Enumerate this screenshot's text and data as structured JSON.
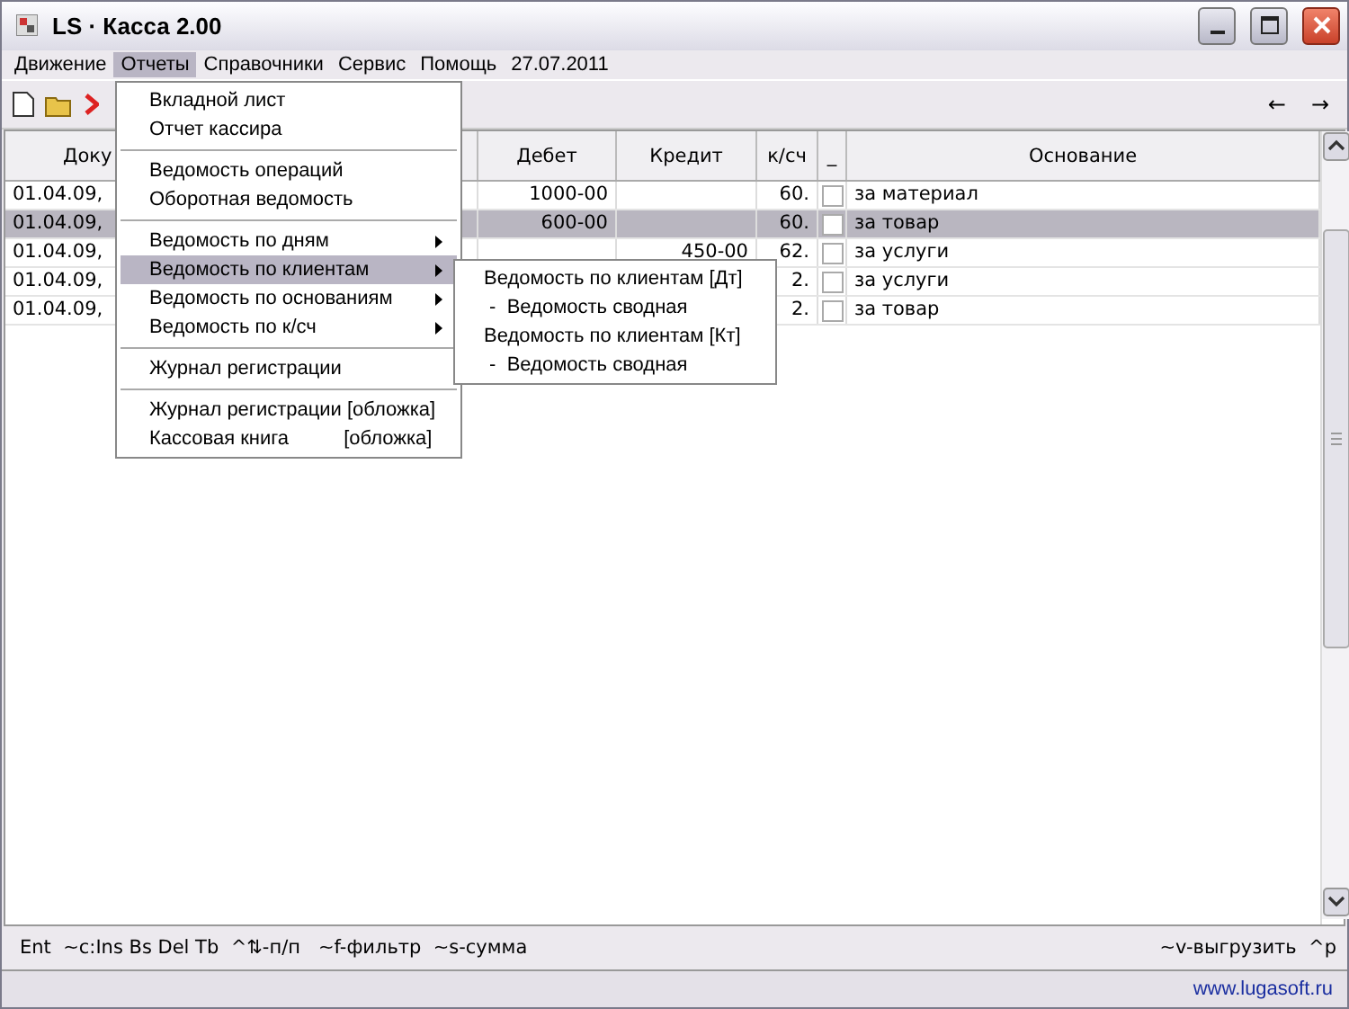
{
  "window": {
    "title": "LS · Касса 2.00"
  },
  "menu_bar": {
    "items": [
      {
        "label": "Движение",
        "selected": false
      },
      {
        "label": "Отчеты",
        "selected": true
      },
      {
        "label": "Справочники",
        "selected": false
      },
      {
        "label": "Сервис",
        "selected": false
      },
      {
        "label": "Помощь",
        "selected": false
      }
    ],
    "date": "27.07.2011"
  },
  "toolbar": {
    "nav": [
      "←",
      "→"
    ]
  },
  "table": {
    "columns": [
      {
        "label": "Доку"
      },
      {
        "label": "Дебет"
      },
      {
        "label": "Кредит"
      },
      {
        "label": "к/сч"
      },
      {
        "label": "_"
      },
      {
        "label": "Основание"
      }
    ],
    "rows": [
      {
        "date": "01.04.09,",
        "debit": "1000-00",
        "credit": "",
        "account": "60.",
        "checked": false,
        "reason": "за материал",
        "selected": false
      },
      {
        "date": "01.04.09,",
        "debit": "600-00",
        "credit": "",
        "account": "60.",
        "checked": false,
        "reason": "за товар",
        "selected": true
      },
      {
        "date": "01.04.09,",
        "debit": "",
        "credit": "450-00",
        "account": "62.",
        "checked": false,
        "reason": "за услуги",
        "selected": false
      },
      {
        "date": "01.04.09,",
        "debit": "",
        "credit": "",
        "account": "2.",
        "checked": false,
        "reason": "за услуги",
        "selected": false
      },
      {
        "date": "01.04.09,",
        "debit": "",
        "credit": "",
        "account": "2.",
        "checked": false,
        "reason": "за товар",
        "selected": false
      }
    ]
  },
  "dropdown": {
    "items": [
      {
        "kind": "item",
        "label": "Вкладной лист",
        "submenu": false,
        "selected": false
      },
      {
        "kind": "item",
        "label": "Отчет кассира",
        "submenu": false,
        "selected": false
      },
      {
        "kind": "separator"
      },
      {
        "kind": "item",
        "label": "Ведомость операций",
        "submenu": false,
        "selected": false
      },
      {
        "kind": "item",
        "label": "Оборотная ведомость",
        "submenu": false,
        "selected": false
      },
      {
        "kind": "separator"
      },
      {
        "kind": "item",
        "label": "Ведомость по дням",
        "submenu": true,
        "selected": false
      },
      {
        "kind": "item",
        "label": "Ведомость по клиентам",
        "submenu": true,
        "selected": true
      },
      {
        "kind": "item",
        "label": "Ведомость по основаниям",
        "submenu": true,
        "selected": false
      },
      {
        "kind": "item",
        "label": "Ведомость по к/сч",
        "submenu": true,
        "selected": false
      },
      {
        "kind": "separator"
      },
      {
        "kind": "item",
        "label": "Журнал регистрации",
        "submenu": false,
        "selected": false
      },
      {
        "kind": "separator"
      },
      {
        "kind": "item",
        "label": "Журнал регистрации [обложка]",
        "submenu": false,
        "selected": false
      },
      {
        "kind": "item",
        "label": "Кассовая книга          [обложка]",
        "submenu": false,
        "selected": false
      }
    ]
  },
  "submenu": {
    "items": [
      "Ведомость по клиентам [Дт]",
      " -  Ведомость сводная",
      "Ведомость по клиентам [Кт]",
      " -  Ведомость сводная"
    ]
  },
  "status_bar": {
    "left": "Ent  ~c:Ins Bs Del Tb  ^⇅-п/п   ~f-фильтр  ~s-сумма",
    "right": "~v-выгрузить  ^p"
  },
  "footer": {
    "link": "www.lugasoft.ru"
  }
}
